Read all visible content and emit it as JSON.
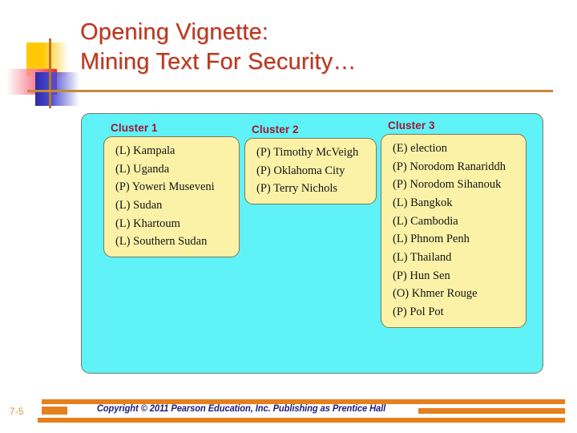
{
  "slide": {
    "title": "Opening Vignette:\nMining Text For Security…",
    "title_color": "#c0341a",
    "number": "7-5",
    "copyright": "Copyright © 2011 Pearson Education, Inc. Publishing as Prentice Hall"
  },
  "theme": {
    "container_fill": "#5ff2f7",
    "box_fill": "#fbf2a8",
    "cluster_heading_color": "#a01832",
    "footer_bar_color": "#e5801c",
    "copyright_color": "#1d217e",
    "rule_color": "#c28b35"
  },
  "clusters": [
    {
      "label": "Cluster 1",
      "items": [
        "(L) Kampala",
        "(L) Uganda",
        "(P) Yoweri Museveni",
        "(L) Sudan",
        "(L) Khartoum",
        "(L) Southern Sudan"
      ]
    },
    {
      "label": "Cluster 2",
      "items": [
        "(P) Timothy McVeigh",
        "(P) Oklahoma City",
        "(P) Terry Nichols"
      ]
    },
    {
      "label": "Cluster 3",
      "items": [
        "(E) election",
        "(P) Norodom Ranariddh",
        "(P) Norodom Sihanouk",
        "(L) Bangkok",
        "(L) Cambodia",
        "(L) Phnom Penh",
        "(L) Thailand",
        "(P) Hun Sen",
        "(O) Khmer Rouge",
        "(P) Pol Pot"
      ]
    }
  ]
}
